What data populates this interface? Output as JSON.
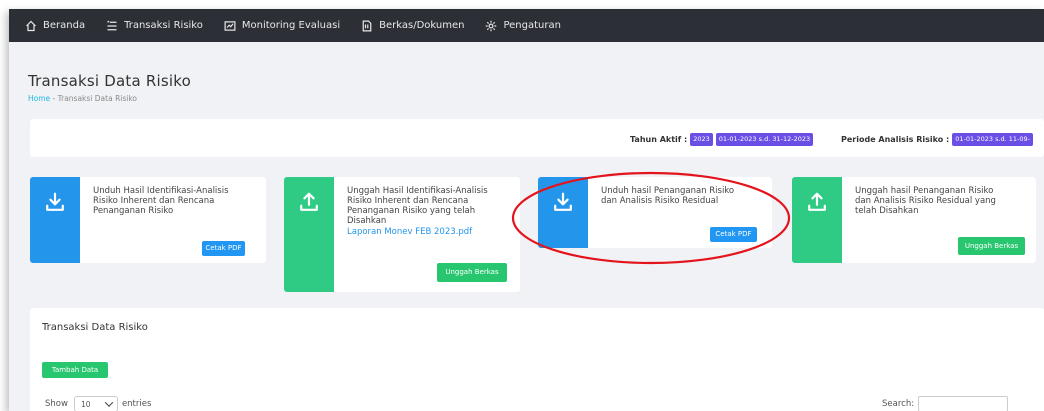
{
  "nav": {
    "items": [
      {
        "label": "Beranda",
        "icon": "home-icon"
      },
      {
        "label": "Transaksi Risiko",
        "icon": "list-icon"
      },
      {
        "label": "Monitoring Evaluasi",
        "icon": "chart-icon"
      },
      {
        "label": "Berkas/Dokumen",
        "icon": "document-icon"
      },
      {
        "label": "Pengaturan",
        "icon": "gear-icon"
      }
    ]
  },
  "header": {
    "title": "Transaksi Data Risiko",
    "breadcrumb_home": "Home",
    "breadcrumb_sep": " - ",
    "breadcrumb_current": "Transaksi Data Risiko"
  },
  "info": {
    "tahun_label": "Tahun Aktif :",
    "tahun_value": "2023",
    "tahun_range": "01-01-2023 s.d. 31-12-2023",
    "periode_label": "Periode Analisis Risiko :",
    "periode_value": "01-01-2023 s.d. 11-09-"
  },
  "cards": [
    {
      "lines": [
        "Unduh Hasil Identifikasi-Analisis",
        "Risiko Inherent dan Rencana",
        "Penanganan Risiko"
      ],
      "button": "Cetak PDF",
      "icon": "download-icon",
      "color": "#2396ec"
    },
    {
      "lines": [
        "Unggah Hasil Identifikasi-Analisis",
        "Risiko Inherent dan Rencana",
        "Penanganan Risiko yang telah",
        "Disahkan"
      ],
      "link": "Laporan Monev FEB 2023.pdf",
      "button": "Unggah Berkas",
      "icon": "upload-icon",
      "color": "#2fcb85"
    },
    {
      "lines": [
        "Unduh hasil Penanganan Risiko",
        "dan Analisis Risiko Residual"
      ],
      "button": "Cetak PDF",
      "icon": "download-icon",
      "color": "#2396ec"
    },
    {
      "lines": [
        "Unggah hasil Penanganan Risiko",
        "dan Analisis Risiko Residual yang",
        "telah Disahkan"
      ],
      "button": "Unggah Berkas",
      "icon": "upload-icon",
      "color": "#2fcb85"
    }
  ],
  "panel": {
    "title": "Transaksi Data Risiko",
    "add_button": "Tambah Data",
    "show_label": "Show",
    "entries_value": "10",
    "entries_label": "entries",
    "search_label": "Search:"
  },
  "annotation_color": "#e3141b"
}
